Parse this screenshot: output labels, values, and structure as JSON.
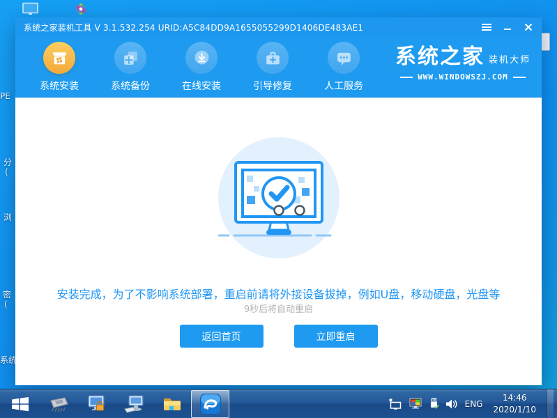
{
  "window": {
    "title": "系统之家装机工具 V 3.1.532.254 URID:A5C84DD9A1655055299D1406DE483AE1",
    "nav": {
      "items": [
        {
          "label": "系统安装",
          "icon": "install-box-icon",
          "active": true
        },
        {
          "label": "系统备份",
          "icon": "backup-icon",
          "active": false
        },
        {
          "label": "在线安装",
          "icon": "online-download-icon",
          "active": false
        },
        {
          "label": "引导修复",
          "icon": "boot-repair-icon",
          "active": false
        },
        {
          "label": "人工服务",
          "icon": "support-chat-icon",
          "active": false
        }
      ]
    },
    "logo": {
      "brand": "系统之家",
      "tagline": "装机大师",
      "website": "WWW.WINDOWSZJ.COM"
    },
    "main": {
      "message": "安装完成，为了不影响系统部署，重启前请将外接设备拔掉，例如U盘，移动硬盘，光盘等",
      "countdown": "9秒后将自动重启",
      "back_button": "返回首页",
      "restart_button": "立即重启"
    }
  },
  "desktop": {
    "edge_labels": {
      "l1": "PE",
      "l2": "分",
      "l3": "(",
      "l4": "浏",
      "l5": "密",
      "l6": "(",
      "l7": "系统"
    }
  },
  "taskbar": {
    "language": "ENG",
    "clock": {
      "time": "14:46",
      "date": "2020/1/10"
    }
  },
  "colors": {
    "accent": "#1e9bf0",
    "active_nav": "#f5b03a",
    "taskbar": "#24599a",
    "message_text": "#2196f3",
    "desktop": "#0f8fee"
  }
}
